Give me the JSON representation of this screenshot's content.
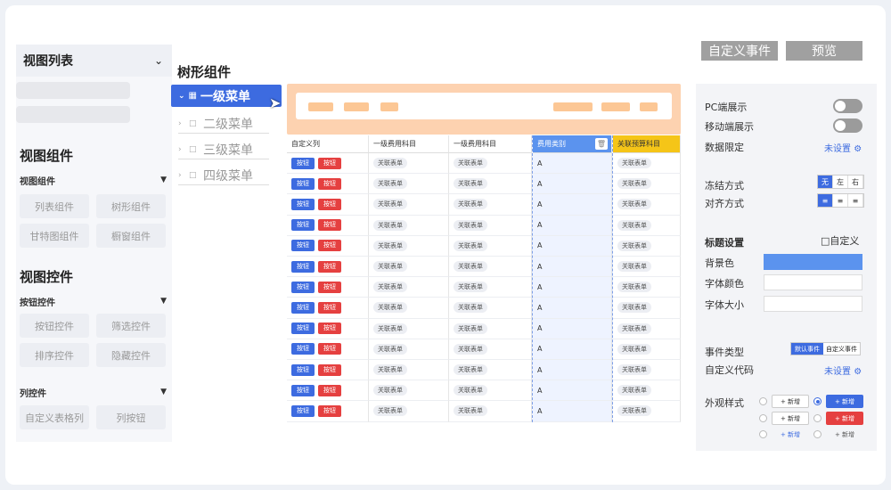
{
  "left_panel": {
    "view_list": {
      "title": "视图列表",
      "chevron": "chevron-down-icon"
    },
    "view_components": {
      "title": "视图组件",
      "group_label": "视图组件",
      "tiles": [
        "列表组件",
        "树形组件",
        "甘特图组件",
        "橱窗组件"
      ]
    },
    "view_controls": {
      "title": "视图控件",
      "button_group": {
        "label": "按钮控件",
        "tiles": [
          "按钮控件",
          "筛选控件",
          "排序控件",
          "隐藏控件"
        ]
      },
      "column_group": {
        "label": "列控件",
        "tiles": [
          "自定义表格列",
          "列按钮"
        ]
      }
    }
  },
  "tree": {
    "title": "树形组件",
    "items": [
      "一级菜单",
      "二级菜单",
      "三级菜单",
      "四级菜单"
    ]
  },
  "toolbar": {
    "custom_event": "自定义事件",
    "preview": "预览"
  },
  "table": {
    "headers": [
      "自定义列",
      "一级费用科目",
      "一级费用科目",
      "费用类别",
      "关联预算科目"
    ],
    "btn_primary": "按钮",
    "btn_danger": "按钮",
    "tag": "关联表单",
    "category_value": "A",
    "row_count": 13
  },
  "right_panel": {
    "pc_display": "PC端展示",
    "mobile_display": "移动端展示",
    "data_limit": "数据限定",
    "not_set": "未设置",
    "freeze_mode": "冻结方式",
    "freeze_options": [
      "无",
      "左",
      "右"
    ],
    "align_mode": "对齐方式",
    "title_settings": "标题设置",
    "custom_checkbox": "□自定义",
    "bg_color": "背景色",
    "font_color": "字体颜色",
    "font_size": "字体大小",
    "event_type": "事件类型",
    "event_options": [
      "默认事件",
      "自定义事件"
    ],
    "custom_code": "自定义代码",
    "appearance": "外观样式",
    "add_label": "+ 新增",
    "colors": {
      "accent": "#3d6be0",
      "danger": "#e54040",
      "header_yellow": "#f5c518",
      "bg_swatch": "#5b93ee"
    }
  }
}
